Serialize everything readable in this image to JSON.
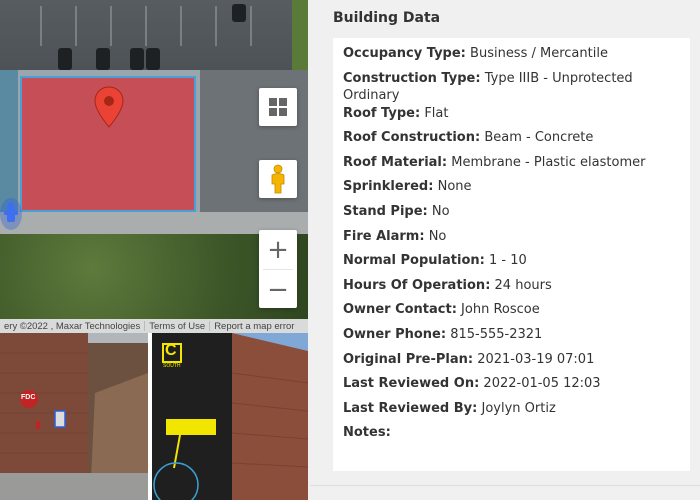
{
  "map": {
    "attribution": {
      "imagery": "ery ©2022 , Maxar Technologies",
      "terms": "Terms of Use",
      "report": "Report a map error"
    },
    "controls": {
      "layers_icon": "grid-icon",
      "streetview_icon": "pegman-icon",
      "zoom_in": "+",
      "zoom_out": "−"
    },
    "pin_icon": "map-pin-icon",
    "hydrant_icon": "hydrant-icon"
  },
  "photos": [
    {
      "name": "building-side-photo",
      "labels": [
        "FDC"
      ]
    },
    {
      "name": "building-south-photo",
      "labels": [
        "C",
        "SOUTH"
      ]
    }
  ],
  "panel": {
    "title": "Building Data",
    "rows": [
      {
        "label": "Occupancy Type:",
        "value": "Business / Mercantile"
      },
      {
        "label": "Construction Type:",
        "value": "Type IIIB - Unprotected Ordinary"
      },
      {
        "label": "Roof Type:",
        "value": "Flat"
      },
      {
        "label": "Roof Construction:",
        "value": "Beam - Concrete"
      },
      {
        "label": "Roof Material:",
        "value": "Membrane - Plastic elastomer"
      },
      {
        "label": "Sprinklered:",
        "value": "None"
      },
      {
        "label": "Stand Pipe:",
        "value": "No"
      },
      {
        "label": "Fire Alarm:",
        "value": "No"
      },
      {
        "label": "Normal Population:",
        "value": "1 - 10"
      },
      {
        "label": "Hours Of Operation:",
        "value": "24 hours"
      },
      {
        "label": "Owner Contact:",
        "value": "John Roscoe"
      },
      {
        "label": "Owner Phone:",
        "value": "815-555-2321"
      },
      {
        "label": "Original Pre-Plan:",
        "value": "2021-03-19 07:01"
      },
      {
        "label": "Last Reviewed On:",
        "value": "2022-01-05 12:03"
      },
      {
        "label": "Last Reviewed By:",
        "value": "Joylyn Ortiz"
      },
      {
        "label": "Notes:",
        "value": ""
      }
    ]
  },
  "colors": {
    "building_overlay": "#ce4048",
    "building_outline": "#4aa0d6",
    "pin_red": "#ea4335",
    "hydrant_blue": "#2b5fd9"
  }
}
